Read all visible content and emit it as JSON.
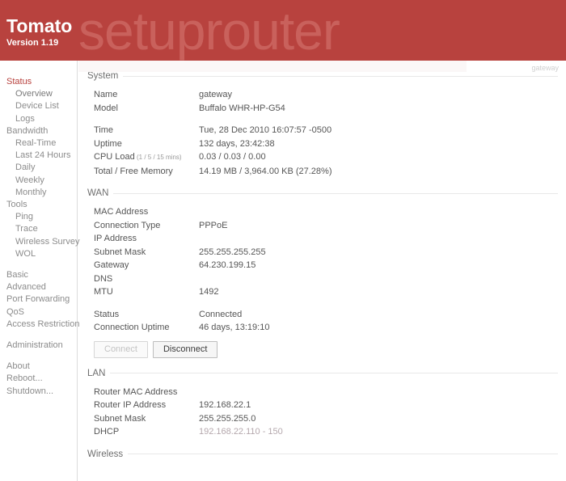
{
  "header": {
    "brand_title": "Tomato",
    "brand_version": "Version 1.19",
    "watermark": "setuprouter",
    "bg_color": "#b8423e"
  },
  "content": {
    "host_label": "gateway"
  },
  "sidebar": {
    "groups": [
      {
        "title": "Status",
        "title_active": true,
        "items": [
          {
            "label": "Overview",
            "selected": true
          },
          {
            "label": "Device List",
            "selected": false
          },
          {
            "label": "Logs",
            "selected": false
          }
        ]
      },
      {
        "title": "Bandwidth",
        "title_active": false,
        "items": [
          {
            "label": "Real-Time",
            "selected": false
          },
          {
            "label": "Last 24 Hours",
            "selected": false
          },
          {
            "label": "Daily",
            "selected": false
          },
          {
            "label": "Weekly",
            "selected": false
          },
          {
            "label": "Monthly",
            "selected": false
          }
        ]
      },
      {
        "title": "Tools",
        "title_active": false,
        "items": [
          {
            "label": "Ping",
            "selected": false
          },
          {
            "label": "Trace",
            "selected": false
          },
          {
            "label": "Wireless Survey",
            "selected": false
          },
          {
            "label": "WOL",
            "selected": false
          }
        ]
      }
    ],
    "links_main": [
      {
        "label": "Basic"
      },
      {
        "label": "Advanced"
      },
      {
        "label": "Port Forwarding"
      },
      {
        "label": "QoS"
      },
      {
        "label": "Access Restriction"
      }
    ],
    "links_admin": [
      {
        "label": "Administration"
      }
    ],
    "links_footer": [
      {
        "label": "About"
      },
      {
        "label": "Reboot..."
      },
      {
        "label": "Shutdown..."
      }
    ]
  },
  "sections": {
    "system": {
      "title": "System",
      "rows": [
        {
          "name": "Name",
          "value": "gateway"
        },
        {
          "name": "Model",
          "value": "Buffalo WHR-HP-G54"
        },
        {
          "spacer": true
        },
        {
          "name": "Time",
          "value": "Tue, 28 Dec 2010 16:07:57 -0500"
        },
        {
          "name": "Uptime",
          "value": "132 days, 23:42:38"
        },
        {
          "name": "CPU Load",
          "note": "(1 / 5 / 15 mins)",
          "value": "0.03 / 0.03 / 0.00"
        },
        {
          "name": "Total / Free Memory",
          "value": "14.19 MB / 3,964.00 KB (27.28%)"
        }
      ]
    },
    "wan": {
      "title": "WAN",
      "rows": [
        {
          "name": "MAC Address",
          "value": ""
        },
        {
          "name": "Connection Type",
          "value": "PPPoE"
        },
        {
          "name": "IP Address",
          "value": ""
        },
        {
          "name": "Subnet Mask",
          "value": "255.255.255.255"
        },
        {
          "name": "Gateway",
          "value": "64.230.199.15"
        },
        {
          "name": "DNS",
          "value": ""
        },
        {
          "name": "MTU",
          "value": "1492"
        },
        {
          "spacer": true
        },
        {
          "name": "Status",
          "value": "Connected"
        },
        {
          "name": "Connection Uptime",
          "value": "46 days, 13:19:10"
        }
      ],
      "buttons": [
        {
          "label": "Connect",
          "disabled": true
        },
        {
          "label": "Disconnect",
          "disabled": false
        }
      ]
    },
    "lan": {
      "title": "LAN",
      "rows": [
        {
          "name": "Router MAC Address",
          "value": ""
        },
        {
          "name": "Router IP Address",
          "value": "192.168.22.1"
        },
        {
          "name": "Subnet Mask",
          "value": "255.255.255.0"
        },
        {
          "name": "DHCP",
          "value": "192.168.22.110 - 150",
          "muted": true
        }
      ]
    },
    "wireless": {
      "title": "Wireless"
    }
  }
}
